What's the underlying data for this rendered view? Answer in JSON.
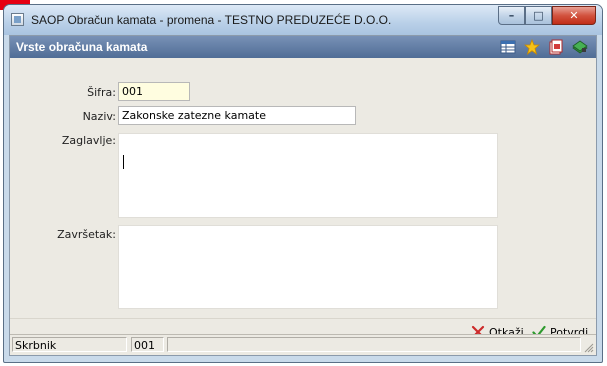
{
  "window": {
    "title": "SAOP Obračun kamata - promena - TESTNO PREDUZEĆE D.O.O.",
    "minimize": "–",
    "maximize": "□",
    "close": "✕"
  },
  "header": {
    "title": "Vrste obračuna kamata",
    "icons": [
      "table-icon",
      "star-icon",
      "export-icon",
      "books-icon"
    ]
  },
  "form": {
    "sifra_label": "Šifra:",
    "sifra_value": "001",
    "naziv_label": "Naziv:",
    "naziv_value": "Zakonske zatezne kamate",
    "zaglavlje_label": "Zaglavlje:",
    "zavrsetak_label": "Završetak:"
  },
  "buttons": {
    "cancel_underlined": "O",
    "cancel_rest": "tkaži",
    "confirm_underlined": "P",
    "confirm_rest": "otvrdi"
  },
  "statusbar": {
    "user": "Skrbnik",
    "code": "001",
    "extra": ""
  },
  "colors": {
    "header_bar": "#5f7aa3",
    "client_bg": "#eceae3",
    "sifra_bg": "#fffde0",
    "cancel_icon": "#cc2b2b",
    "confirm_icon": "#2e9a2e"
  }
}
